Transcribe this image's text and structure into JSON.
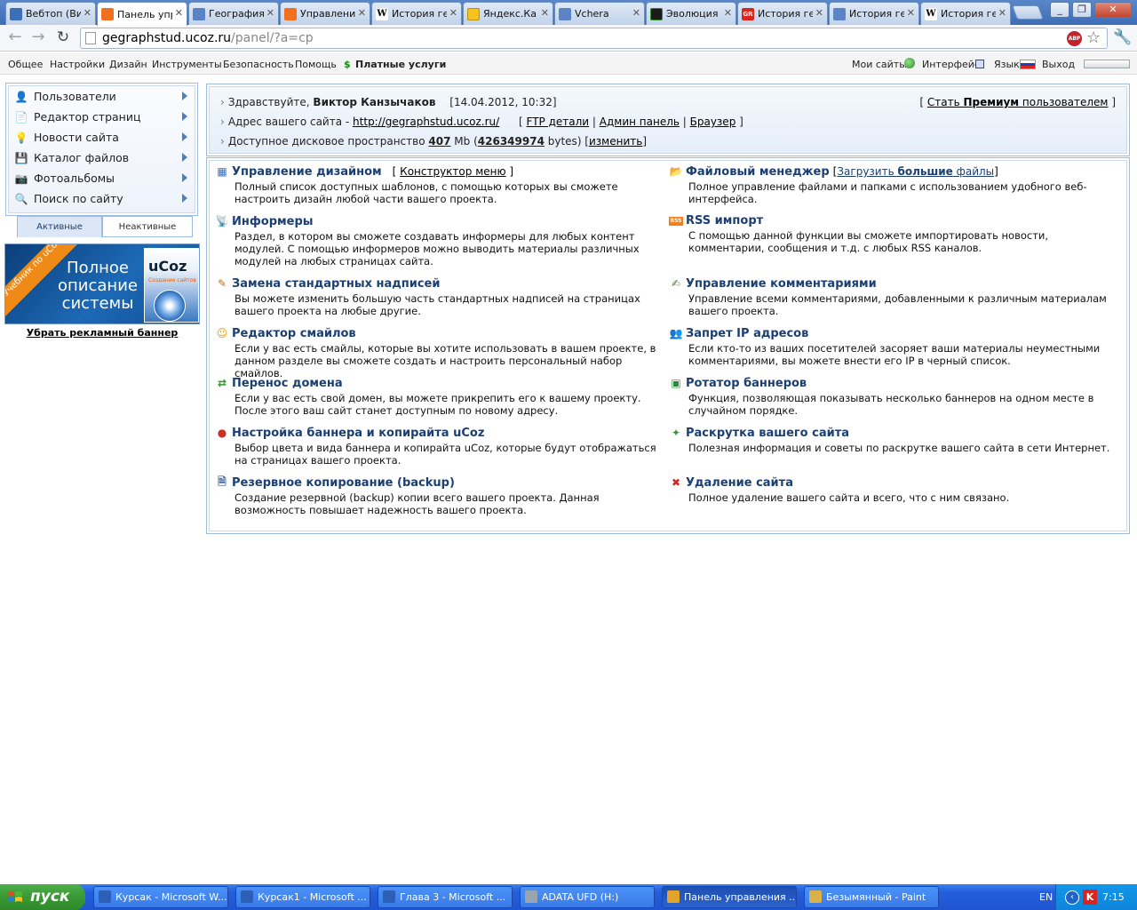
{
  "tabs": [
    {
      "title": "Вебтоп (Ви",
      "icon": "webtop",
      "color": "#3b6fb8",
      "active": false
    },
    {
      "title": "Панель упр",
      "icon": "ucoz",
      "color": "#f07020",
      "active": true
    },
    {
      "title": "География",
      "icon": "globe",
      "color": "#5a84c6",
      "active": false
    },
    {
      "title": "Управление",
      "icon": "ucoz",
      "color": "#f07020",
      "active": false
    },
    {
      "title": "История ге",
      "icon": "wikipedia",
      "color": "#ffffff",
      "active": false
    },
    {
      "title": "Яндекс.Ка",
      "icon": "yandex",
      "color": "#f6c21b",
      "active": false
    },
    {
      "title": "Vchera",
      "icon": "globe",
      "color": "#5a84c6",
      "active": false
    },
    {
      "title": "Эволюция",
      "icon": "evolution",
      "color": "#1b1b1b",
      "active": false
    },
    {
      "title": "История ге",
      "icon": "gr",
      "color": "#d8261f",
      "active": false
    },
    {
      "title": "История ге",
      "icon": "globe",
      "color": "#5a84c6",
      "active": false
    },
    {
      "title": "История ге",
      "icon": "wikipedia",
      "color": "#ffffff",
      "active": false
    }
  ],
  "address": {
    "host": "gegraphstud.ucoz.ru",
    "path": "/panel/?a=cp"
  },
  "menubar": {
    "left": [
      "Общее",
      "Настройки",
      "Дизайн",
      "Инструменты",
      "Безопасность",
      "Помощь"
    ],
    "paid": "Платные услуги",
    "my_sites": "Мои сайты",
    "interface": "Интерфейс",
    "language": "Язык",
    "logout": "Выход"
  },
  "sidebar": {
    "items": [
      {
        "label": "Пользователи",
        "icon": "user-icon"
      },
      {
        "label": "Редактор страниц",
        "icon": "page-icon"
      },
      {
        "label": "Новости сайта",
        "icon": "bulb-icon"
      },
      {
        "label": "Каталог файлов",
        "icon": "disk-icon"
      },
      {
        "label": "Фотоальбомы",
        "icon": "camera-icon"
      },
      {
        "label": "Поиск по сайту",
        "icon": "magnifier-icon"
      }
    ],
    "tab_active": "Активные",
    "tab_inactive": "Неактивные"
  },
  "banner": {
    "ribbon": "Учебник по uCoz",
    "headline": "Полное описание системы",
    "box_brand": "uCoz",
    "box_sub": "Создание сайтов"
  },
  "remove_banner": "Убрать рекламный баннер",
  "info": {
    "greeting": "Здравствуйте,",
    "user": "Виктор Канзычаков",
    "datetime": "[14.04.2012, 10:32]",
    "premium_pre": "[",
    "premium_link_a": "Стать ",
    "premium_link_b": "Премиум",
    "premium_link_c": " пользователем",
    "premium_post": "]",
    "site_label": "Адрес вашего сайта -",
    "site_url": "http://gegraphstud.ucoz.ru/",
    "ftp": "FTP детали",
    "admin": "Админ панель",
    "browser": "Браузер",
    "disk_label": "Доступное дисковое пространство",
    "disk_mb": "407",
    "disk_mb_unit": "Mb",
    "disk_bytes": "426349974",
    "disk_bytes_unit": "bytes",
    "change": "изменить"
  },
  "panel": {
    "left": [
      {
        "title": "Управление дизайном",
        "extra": "Конструктор меню",
        "icon": "layout-icon",
        "desc": "Полный список доступных шаблонов, с помощью которых вы сможете настроить дизайн любой части вашего проекта."
      },
      {
        "title": "Информеры",
        "icon": "antenna-icon",
        "desc": "Раздел, в котором вы сможете создавать информеры для любых контент модулей. С помощью информеров можно выводить материалы различных модулей на любых страницах сайта."
      },
      {
        "title": "Замена стандартных надписей",
        "icon": "edit-text-icon",
        "desc": "Вы можете изменить большую часть стандартных надписей на страницах вашего проекта на любые другие."
      },
      {
        "title": "Редактор смайлов",
        "icon": "smiley-icon",
        "desc": "Если у вас есть смайлы, которые вы хотите использовать в вашем проекте, в данном разделе вы сможете создать и настроить персональный набор смайлов."
      },
      {
        "title": "Перенос домена",
        "icon": "transfer-icon",
        "desc": "Если у вас есть свой домен, вы можете прикрепить его к вашему проекту. После этого ваш сайт станет доступным по новому адресу."
      },
      {
        "title": "Настройка баннера и копирайта uCoz",
        "icon": "banner-settings-icon",
        "desc": "Выбор цвета и вида баннера и копирайта uCoz, которые будут отображаться на страницах вашего проекта."
      },
      {
        "title": "Резервное копирование (backup)",
        "icon": "backup-icon",
        "desc": "Создание резервной (backup) копии всего вашего проекта. Данная возможность повышает надежность вашего проекта."
      }
    ],
    "right": [
      {
        "title": "Файловый менеджер",
        "extra_pre": "[",
        "extra_a": "Загрузить ",
        "extra_b": "большие",
        "extra_c": " файлы",
        "extra_post": "]",
        "icon": "folder-icon",
        "desc": "Полное управление файлами и папками с использованием удобного веб-интерфейса."
      },
      {
        "title": "RSS импорт",
        "icon": "rss-icon",
        "desc": "С помощью данной функции вы сможете импортировать новости, комментарии, сообщения и т.д. с любых RSS каналов."
      },
      {
        "title": "Управление комментариями",
        "icon": "comments-icon",
        "desc": "Управление всеми комментариями, добавленными к различным материалам вашего проекта."
      },
      {
        "title": "Запрет IP адресов",
        "icon": "ip-ban-icon",
        "desc": "Если кто-то из ваших посетителей засоряет ваши материалы неуместными комментариями, вы можете внести его IP в черный список."
      },
      {
        "title": "Ротатор баннеров",
        "icon": "rotator-icon",
        "desc": "Функция, позволяющая показывать несколько баннеров на одном месте в случайном порядке."
      },
      {
        "title": "Раскрутка вашего сайта",
        "icon": "promo-icon",
        "desc": "Полезная информация и советы по раскрутке вашего сайта в сети Интернет."
      },
      {
        "title": "Удаление сайта",
        "icon": "delete-icon",
        "desc": "Полное удаление вашего сайта и всего, что с ним связано."
      }
    ]
  },
  "taskbar": {
    "start": "пуск",
    "tasks": [
      {
        "label": "Курсак - Microsoft W...",
        "icon": "word-icon",
        "color": "#2b5fb8"
      },
      {
        "label": "Курсак1 - Microsoft ...",
        "icon": "word-icon",
        "color": "#2b5fb8"
      },
      {
        "label": "Глава 3 - Microsoft ...",
        "icon": "word-icon",
        "color": "#2b5fb8"
      },
      {
        "label": "ADATA UFD (H:)",
        "icon": "drive-icon",
        "color": "#9aa4b0"
      },
      {
        "label": "Панель управления ...",
        "icon": "chrome-icon",
        "color": "#e2a32a"
      },
      {
        "label": "Безымянный - Paint",
        "icon": "paint-icon",
        "color": "#d9b04a"
      }
    ],
    "lang": "EN",
    "time": "7:15"
  },
  "colors": {
    "link": "#1b3f73",
    "panel_border": "#9dbbe0",
    "taskbar": "#245edb",
    "start": "#3a9a35"
  }
}
